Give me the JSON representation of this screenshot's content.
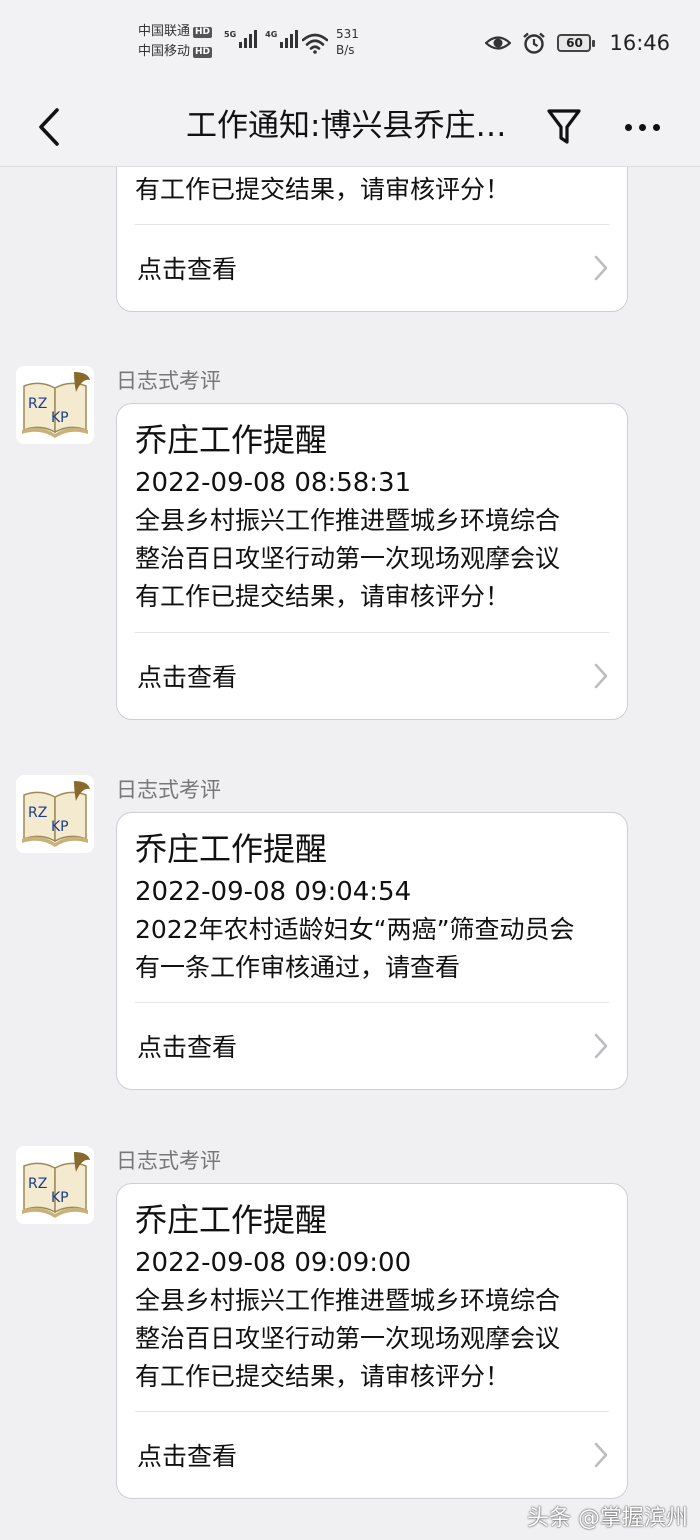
{
  "status_bar": {
    "carrier_1": "中国联通",
    "carrier_2": "中国移动",
    "hd_badge": "HD",
    "network_1": "5G",
    "network_2": "4G",
    "speed_value": "531",
    "speed_unit": "B/s",
    "battery": "60",
    "time": "16:46",
    "icons": [
      "eye-icon",
      "alarm-icon",
      "wifi-icon",
      "signal-icon"
    ]
  },
  "nav": {
    "title": "工作通知:博兴县乔庄…",
    "icons": [
      "back-icon",
      "filter-icon",
      "more-icon"
    ]
  },
  "partial_message": {
    "last_line": "有工作已提交结果，请审核评分！",
    "action_label": "点击查看"
  },
  "messages": [
    {
      "sender": "日志式考评",
      "title": "乔庄工作提醒",
      "time": "2022-09-08 08:58:31",
      "lines": [
        "全县乡村振兴工作推进暨城乡环境综合",
        "整治百日攻坚行动第一次现场观摩会议",
        "有工作已提交结果，请审核评分！"
      ],
      "action_label": "点击查看"
    },
    {
      "sender": "日志式考评",
      "title": "乔庄工作提醒",
      "time": "2022-09-08 09:04:54",
      "lines": [
        "2022年农村适龄妇女“两癌”筛查动员会",
        "有一条工作审核通过，请查看"
      ],
      "action_label": "点击查看"
    },
    {
      "sender": "日志式考评",
      "title": "乔庄工作提醒",
      "time": "2022-09-08 09:09:00",
      "lines": [
        "全县乡村振兴工作推进暨城乡环境综合",
        "整治百日攻坚行动第一次现场观摩会议",
        "有工作已提交结果，请审核评分！"
      ],
      "action_label": "点击查看"
    }
  ],
  "avatar": {
    "letters_top": "RZ",
    "letters_bottom": "KP"
  },
  "watermark": "头条 @掌握滨州",
  "colors": {
    "background": "#f0f0f2",
    "card": "#ffffff",
    "avatar_letters": "#1a3c8c",
    "secondary_text": "#777777"
  }
}
